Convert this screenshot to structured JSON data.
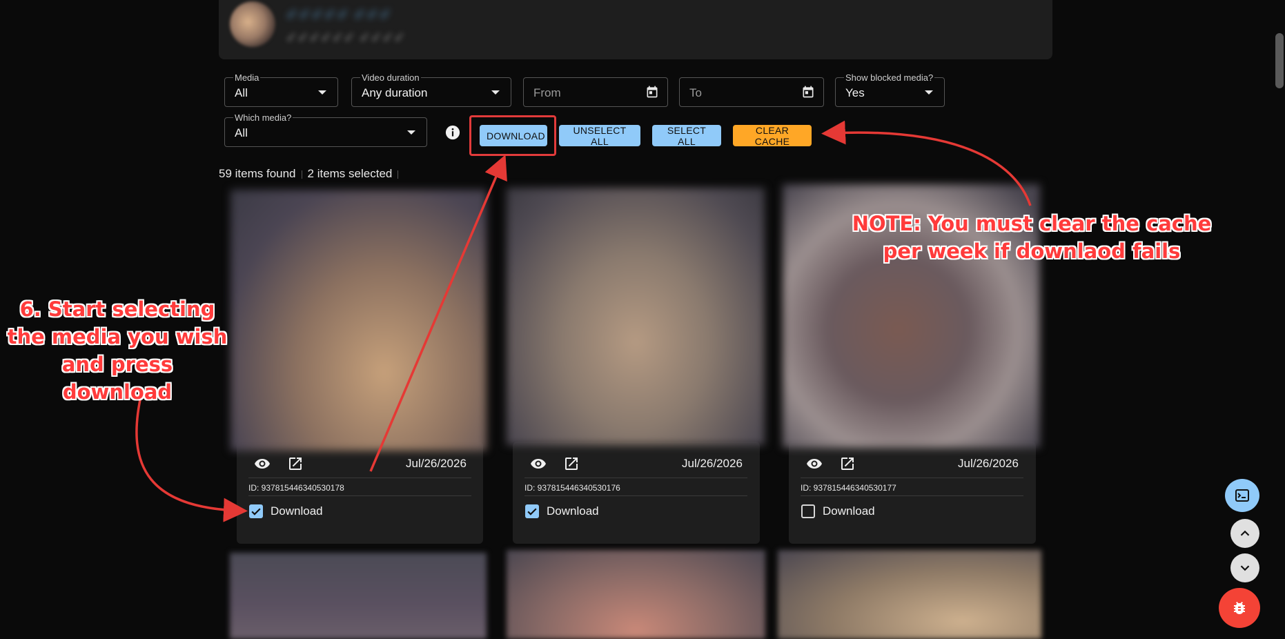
{
  "profile": {
    "name": "✓✓✓✓✓ ✓✓✓",
    "subtitle": "✓✓✓✓✓✓ ✓✓✓✓"
  },
  "filters": {
    "media": {
      "label": "Media",
      "value": "All"
    },
    "video_duration": {
      "label": "Video duration",
      "value": "Any duration"
    },
    "from": {
      "placeholder": "From"
    },
    "to": {
      "placeholder": "To"
    },
    "show_blocked": {
      "label": "Show blocked media?",
      "value": "Yes"
    },
    "which_media": {
      "label": "Which media?",
      "value": "All"
    }
  },
  "toolbar": {
    "download_label": "DOWNLOAD",
    "unselect_all_label": "UNSELECT ALL",
    "select_all_label": "SELECT ALL",
    "clear_cache_label": "CLEAR CACHE"
  },
  "summary": {
    "items_found": "59 items found",
    "items_selected": "2 items selected"
  },
  "cards": [
    {
      "date": "Jul/26/2026",
      "id": "ID: 937815446340530178",
      "checkbox_label": "Download",
      "checked": true
    },
    {
      "date": "Jul/26/2026",
      "id": "ID: 937815446340530176",
      "checkbox_label": "Download",
      "checked": true
    },
    {
      "date": "Jul/26/2026",
      "id": "ID: 937815446340530177",
      "checkbox_label": "Download",
      "checked": false
    }
  ],
  "annotations": {
    "step": "6. Start selecting the media you wish and press download",
    "note": "NOTE: You must clear the cache per week if downlaod fails"
  },
  "colors": {
    "background": "#0a0a0a",
    "surface": "#1e1e1e",
    "primary_button": "#90caf9",
    "warning_button": "#ffa726",
    "annotation": "#ff3b3b",
    "bug_fab": "#f44336"
  }
}
